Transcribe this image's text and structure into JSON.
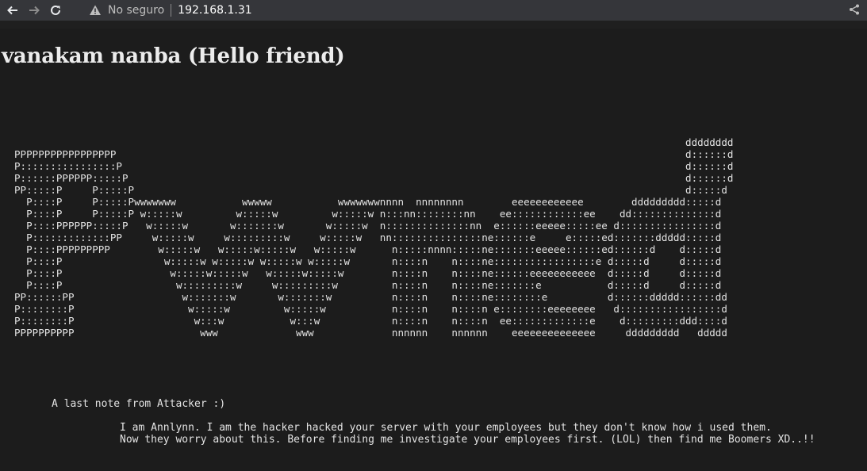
{
  "browser": {
    "security_label": "No seguro",
    "url": "192.168.1.31"
  },
  "page": {
    "title": "vanakam nanba (Hello friend)",
    "ascii_art_lines": [
      "                                                                                                                dddddddd",
      "PPPPPPPPPPPPPPPPP                                                                                               d::::::d",
      "P::::::::::::::::P                                                                                              d::::::d",
      "P::::::PPPPPP:::::P                                                                                             d::::::d",
      "PP:::::P     P:::::P                                                                                            d:::::d",
      "  P::::P     P:::::Pwwwwwww           wwwww           wwwwwwwnnnn  nnnnnnnn        eeeeeeeeeeee        ddddddddd:::::d",
      "  P::::P     P:::::P w:::::w         w:::::w         w:::::w n:::nn::::::::nn    ee::::::::::::ee    dd::::::::::::::d",
      "  P::::PPPPPP:::::P   w:::::w       w:::::::w       w:::::w  n::::::::::::::nn  e::::::eeeee:::::ee d::::::::::::::::d",
      "  P:::::::::::::PP     w:::::w     w:::::::::w     w:::::w   nn:::::::::::::::ne::::::e     e:::::ed:::::::ddddd:::::d",
      "  P::::PPPPPPPPP        w:::::w   w:::::w:::::w   w:::::w      n:::::nnnn:::::ne:::::::eeeee::::::ed::::::d    d:::::d",
      "  P::::P                 w:::::w w:::::w w:::::w w:::::w       n::::n    n::::ne:::::::::::::::::e d:::::d     d:::::d",
      "  P::::P                  w:::::w:::::w   w:::::w:::::w        n::::n    n::::ne::::::eeeeeeeeeee  d:::::d     d:::::d",
      "  P::::P                   w:::::::::w     w:::::::::w         n::::n    n::::ne:::::::e           d:::::d     d:::::d",
      "PP::::::PP                  w:::::::w       w:::::::w          n::::n    n::::ne::::::::e          d::::::ddddd::::::dd",
      "P::::::::P                   w:::::w         w:::::w           n::::n    n::::n e::::::::eeeeeeee   d:::::::::::::::::d",
      "P::::::::P                    w:::w           w:::w            n::::n    n::::n  ee:::::::::::::e    d:::::::::ddd::::d",
      "PPPPPPPPPP                     www             www             nnnnnn    nnnnnn    eeeeeeeeeeeeee     ddddddddd   ddddd"
    ],
    "note_heading": "A last note from Attacker :)",
    "note_line_1": "I am Annlynn. I am the hacker hacked your server with your employees but they don't know how i used them.",
    "note_line_2": "Now they worry about this. Before finding me investigate your employees first. (LOL) then find me Boomers XD..!!"
  }
}
